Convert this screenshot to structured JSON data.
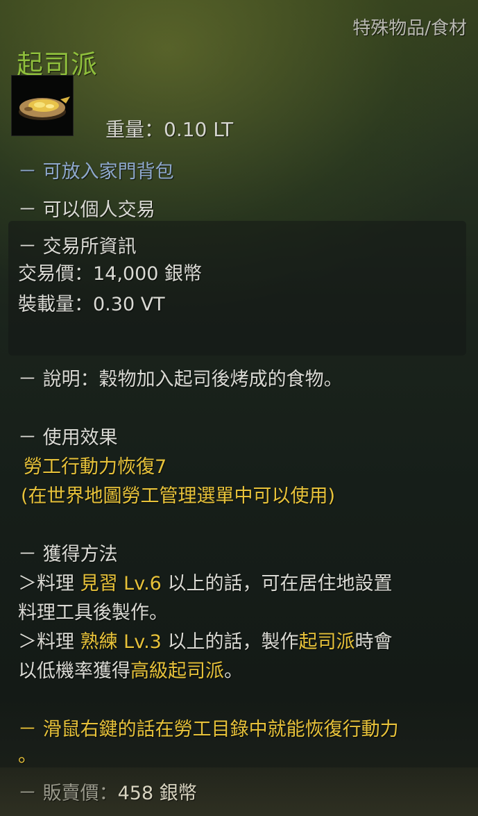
{
  "tooltip": {
    "category": "特殊物品/食材",
    "item_name": "起司派",
    "icon": "cheese-pie-icon",
    "weight_label": "重量：",
    "weight_value": "0.10 LT",
    "family_bag": "－ 可放入家門背包",
    "personal_trade": "－ 可以個人交易",
    "market": {
      "header": "－ 交易所資訊",
      "price_label": "交易價：",
      "price_value": "14,000 銀幣",
      "load_label": "裝載量：",
      "load_value": "0.30 VT"
    },
    "description_label": "－ 說明：",
    "description_text": "穀物加入起司後烤成的食物。",
    "effect": {
      "header": "－ 使用效果",
      "line1": "勞工行動力恢復7",
      "line2": "(在世界地圖勞工管理選單中可以使用)"
    },
    "acquire": {
      "header": "－ 獲得方法",
      "r1_prefix": "＞料理 ",
      "r1_rank": "見習 Lv.6",
      "r1_suffix": " 以上的話，可在居住地設置",
      "r1_cont": "料理工具後製作。",
      "r2_prefix": "＞料理 ",
      "r2_rank": "熟練 Lv.3",
      "r2_mid": " 以上的話，製作",
      "r2_item": "起司派",
      "r2_suffix": "時會",
      "r2_cont_prefix": "以低機率獲得",
      "r2_cont_item": "高級起司派",
      "r2_cont_suffix": "。"
    },
    "right_click_line1": "－ 滑鼠右鍵的話在勞工目錄中就能恢復行動力",
    "right_click_line2": "。",
    "sale_label": "－ 販賣價：",
    "sale_value": "458 銀幣",
    "colors": {
      "name": "#8fbf3c",
      "highlight": "#e7c23a",
      "blue_text": "#8ea8cc",
      "body_text": "#dadad4"
    }
  }
}
